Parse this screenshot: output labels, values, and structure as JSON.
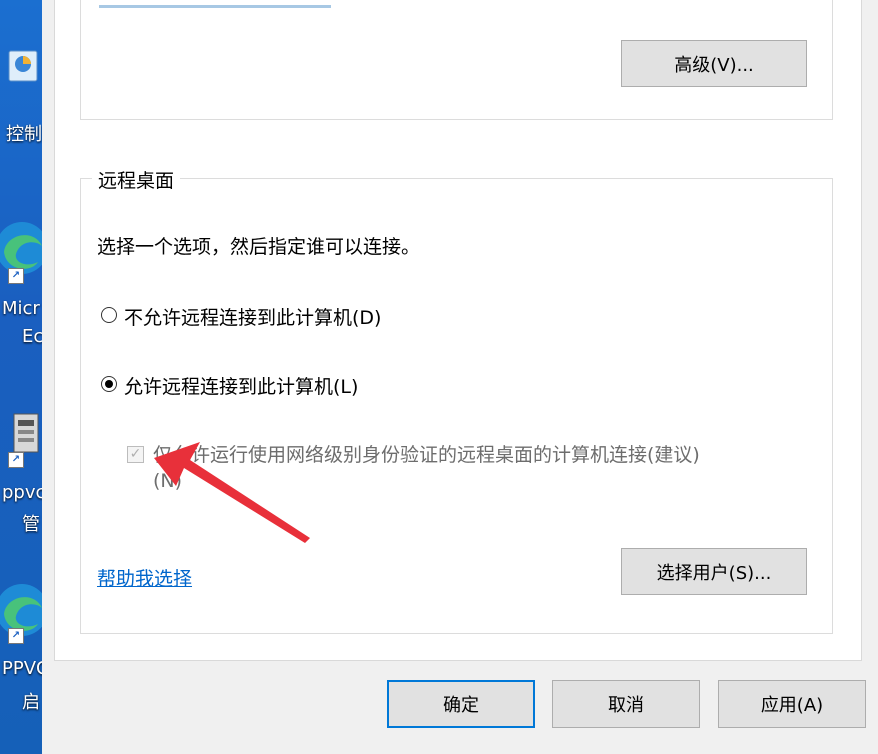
{
  "desktop": {
    "icons": [
      {
        "label": "控制",
        "icon": "control-panel-icon"
      },
      {
        "label_line1": "Micr",
        "label_line2": "Ec",
        "icon": "edge-icon"
      },
      {
        "label_line1": "ppvc",
        "label_line2": "管",
        "icon": "app-icon"
      },
      {
        "label_line1": "PPVC",
        "label_line2": "启",
        "icon": "edge-icon"
      }
    ],
    "shortcut_glyph": "↗"
  },
  "advanced_button": "高级(V)...",
  "remote_desktop": {
    "legend": "远程桌面",
    "instruction": "选择一个选项，然后指定谁可以连接。",
    "option_deny": "不允许远程连接到此计算机(D)",
    "option_allow": "允许远程连接到此计算机(L)",
    "selected": "allow",
    "nla_checkbox": "仅允许运行使用网络级别身份验证的远程桌面的计算机连接(建议)",
    "nla_checkbox_hotkey": "(N)",
    "nla_checked": true,
    "nla_enabled": false,
    "help_link": "帮助我选择",
    "select_users_button": "选择用户(S)..."
  },
  "footer": {
    "ok": "确定",
    "cancel": "取消",
    "apply": "应用(A)"
  },
  "colors": {
    "accent": "#0078d7",
    "link": "#0066cc",
    "annotation_arrow": "#e8303a"
  }
}
